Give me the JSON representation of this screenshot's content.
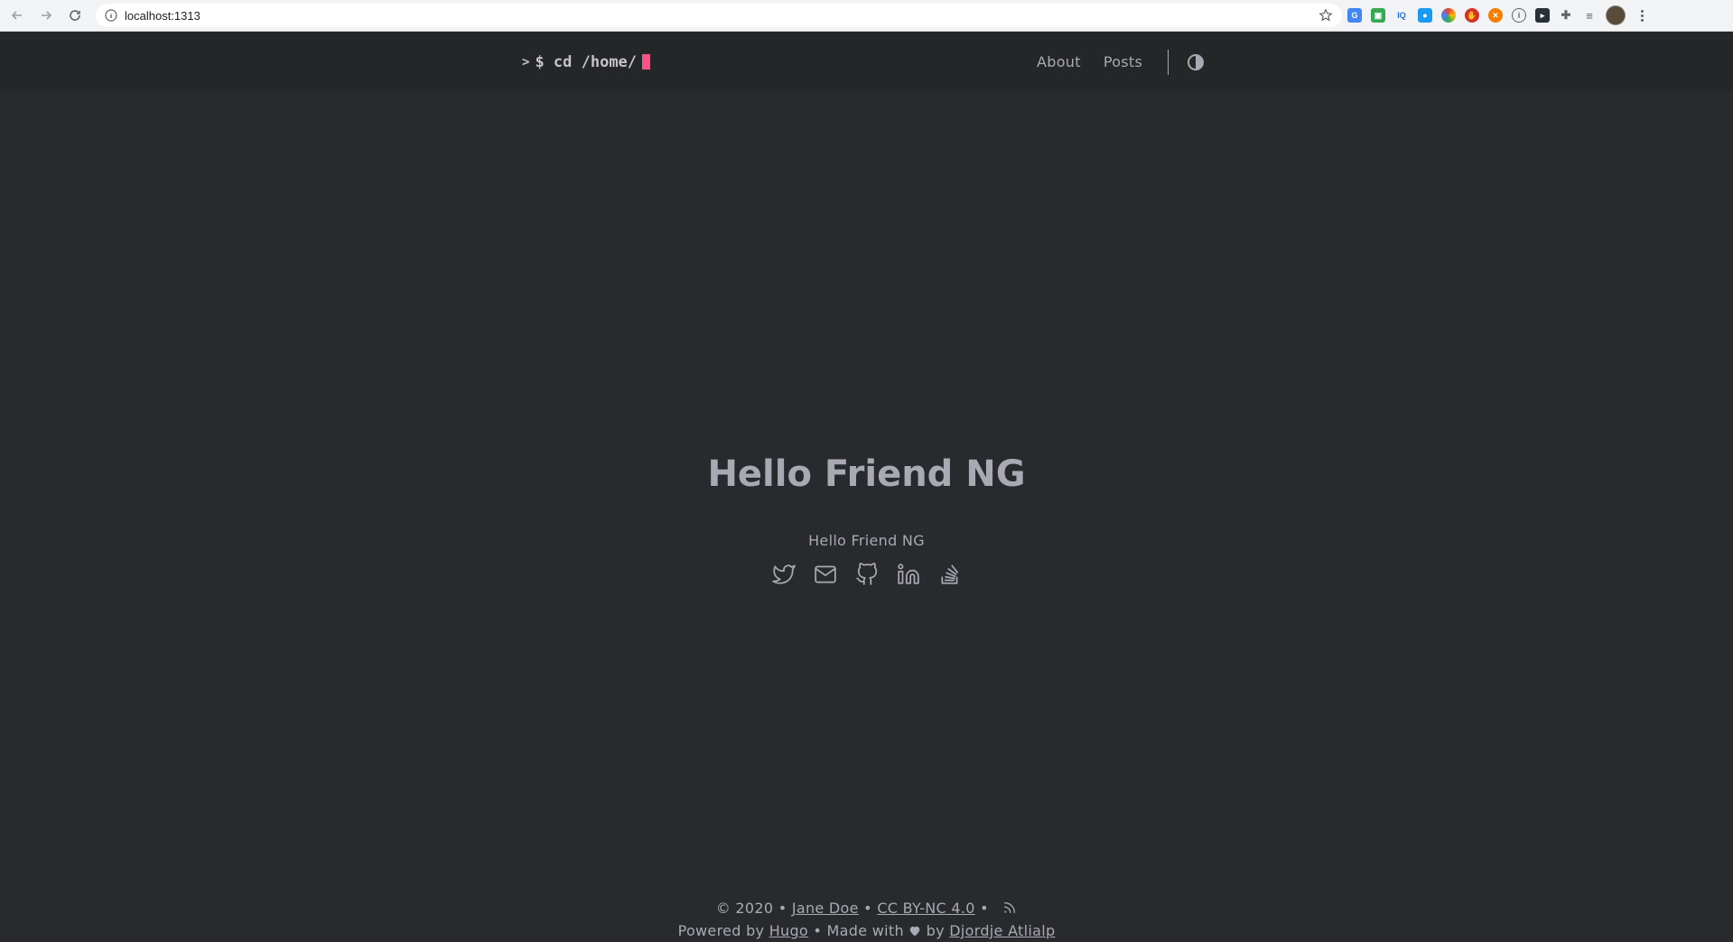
{
  "browser": {
    "url": "localhost:1313",
    "extensions": [
      {
        "name": "translate-icon",
        "color": "#4285f4",
        "glyph": "G"
      },
      {
        "name": "image-ext-icon",
        "color": "#34a853",
        "glyph": "▣"
      },
      {
        "name": "iq-ext-icon",
        "color": "#ffffff",
        "glyph": "IQ"
      },
      {
        "name": "drop-ext-icon",
        "color": "#1a9af7",
        "glyph": "💧"
      },
      {
        "name": "color-ext-icon",
        "color": "#ea4335",
        "glyph": "✿"
      },
      {
        "name": "shield-ext-icon",
        "color": "#d93025",
        "glyph": "✋"
      },
      {
        "name": "orange-ext-icon",
        "color": "#f57c00",
        "glyph": "✕"
      },
      {
        "name": "circle-ext-icon",
        "color": "#ffffff",
        "glyph": "⊙"
      },
      {
        "name": "terminal-ext-icon",
        "color": "#263238",
        "glyph": "▸"
      },
      {
        "name": "puzzle-icon",
        "color": "#ffffff",
        "glyph": "✚"
      },
      {
        "name": "playlist-icon",
        "color": "#ffffff",
        "glyph": "≡"
      }
    ]
  },
  "header": {
    "logo_prompt": ">",
    "logo_text": "$ cd /home/",
    "menu": [
      {
        "label": "About"
      },
      {
        "label": "Posts"
      }
    ]
  },
  "hero": {
    "title": "Hello Friend NG",
    "subtitle": "Hello Friend NG",
    "socials": [
      "twitter",
      "email",
      "github",
      "linkedin",
      "stackoverflow"
    ]
  },
  "footer": {
    "copyright": "© 2020 •",
    "author": "Jane Doe",
    "bullet1": "•",
    "license": "CC BY-NC 4.0",
    "bullet2": "•",
    "powered_by": "Powered by",
    "hugo": "Hugo",
    "made_with": "•  Made with",
    "by": "by",
    "theme_author": "Djordje Atlialp"
  },
  "colors": {
    "background": "#292a2d",
    "header_background": "#252627",
    "text": "#a9a9b3",
    "accent_cursor": "#fe5186"
  }
}
